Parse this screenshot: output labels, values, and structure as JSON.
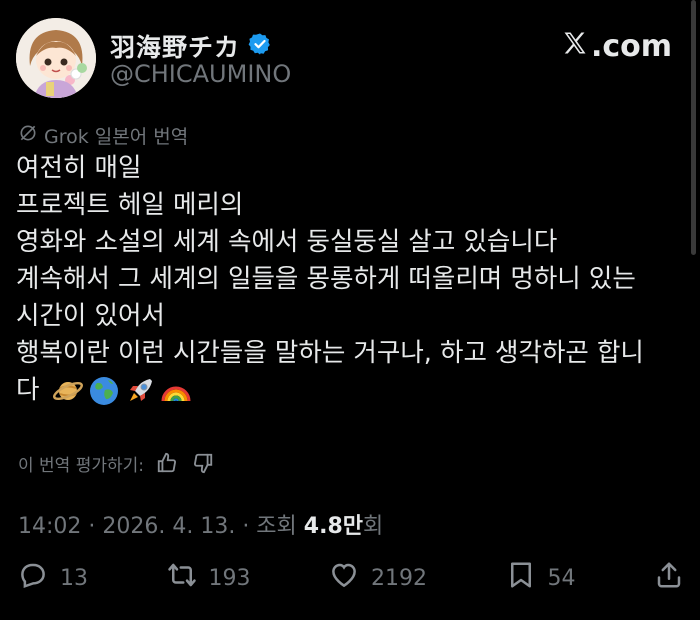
{
  "author": {
    "display_name": "羽海野チカ",
    "handle": "@CHICAUMINO",
    "verified_icon": "verified-badge-icon"
  },
  "site_label": ".com",
  "translation": {
    "label": "Grok 일본어 번역",
    "rate_prompt": "이 번역 평가하기:"
  },
  "post": {
    "lines": [
      "여전히 매일",
      "프로젝트 헤일 메리의",
      "영화와 소설의 세계 속에서 둥실둥실 살고 있습니다",
      "계속해서 그 세계의 일들을 몽롱하게 떠올리며 멍하니 있는",
      "시간이 있어서",
      "행복이란 이런 시간들을 말하는 거구나, 하고 생각하곤 합니",
      "다"
    ],
    "emojis": [
      "saturn-emoji",
      "earth-emoji",
      "rocket-emoji",
      "rainbow-emoji"
    ]
  },
  "meta": {
    "time_date": "14:02 · 2026. 4. 13. · 조회 ",
    "views": "4.8만",
    "views_suffix": "회"
  },
  "actions": {
    "replies": "13",
    "reposts": "193",
    "likes": "2192",
    "bookmarks": "54"
  },
  "colors": {
    "background": "#000000",
    "text": "#e7e9ea",
    "secondary": "#71767b",
    "verified": "#1d9bf0"
  }
}
